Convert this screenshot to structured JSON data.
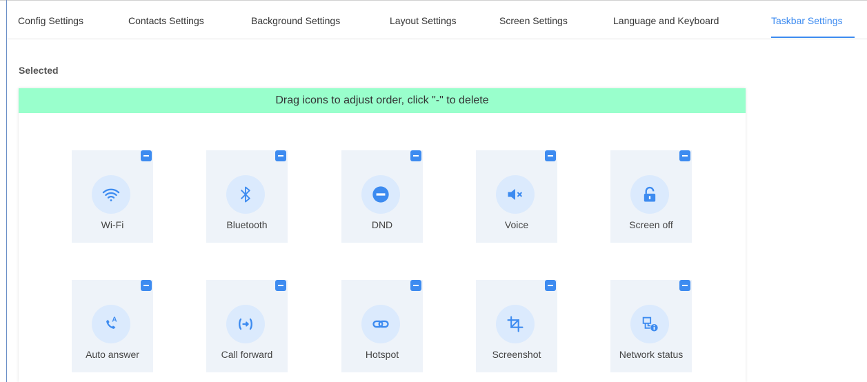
{
  "tabs": [
    {
      "label": "Config Settings"
    },
    {
      "label": "Contacts Settings"
    },
    {
      "label": "Background Settings"
    },
    {
      "label": "Layout Settings"
    },
    {
      "label": "Screen Settings"
    },
    {
      "label": "Language and Keyboard"
    },
    {
      "label": "Taskbar Settings",
      "active": true
    }
  ],
  "section_title": "Selected",
  "banner_text": "Drag icons to adjust order, click \"-\" to delete",
  "accent_color": "#3d8bf0",
  "banner_color": "#99ffcc",
  "items": [
    {
      "label": "Wi-Fi",
      "icon": "wifi-icon"
    },
    {
      "label": "Bluetooth",
      "icon": "bluetooth-icon"
    },
    {
      "label": "DND",
      "icon": "dnd-icon"
    },
    {
      "label": "Voice",
      "icon": "speaker-mute-icon"
    },
    {
      "label": "Screen off",
      "icon": "lock-icon"
    },
    {
      "label": "Auto answer",
      "icon": "auto-answer-icon"
    },
    {
      "label": "Call forward",
      "icon": "call-forward-icon"
    },
    {
      "label": "Hotspot",
      "icon": "link-icon"
    },
    {
      "label": "Screenshot",
      "icon": "crop-icon"
    },
    {
      "label": "Network status",
      "icon": "network-status-icon"
    }
  ]
}
